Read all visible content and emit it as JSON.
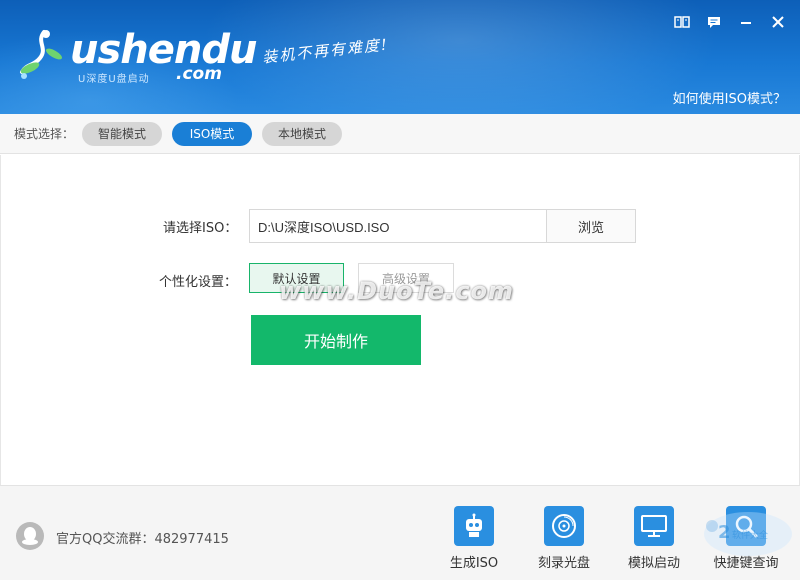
{
  "header": {
    "logo_text": "ushendu",
    "logo_sub": "U深度U盘启动",
    "logo_com": ".com",
    "slogan": "装机不再有难度!",
    "help_link": "如何使用ISO模式？",
    "icons": [
      "book-icon",
      "chat-icon",
      "minimize-icon",
      "close-icon"
    ]
  },
  "mode_bar": {
    "label": "模式选择：",
    "modes": [
      {
        "label": "智能模式",
        "active": false
      },
      {
        "label": "ISO模式",
        "active": true
      },
      {
        "label": "本地模式",
        "active": false
      }
    ]
  },
  "iso_section": {
    "label": "请选择ISO：",
    "value": "D:\\U深度ISO\\USD.ISO",
    "browse_label": "浏览"
  },
  "custom_section": {
    "label": "个性化设置：",
    "default_label": "默认设置",
    "advanced_label": "高级设置"
  },
  "start_button": "开始制作",
  "watermark": "www.DuoTe.com",
  "footer": {
    "qq_text": "官方QQ交流群：482977415",
    "tools": [
      {
        "label": "生成ISO",
        "icon": "robot-icon"
      },
      {
        "label": "刻录光盘",
        "icon": "disc-icon"
      },
      {
        "label": "模拟启动",
        "icon": "monitor-icon"
      },
      {
        "label": "快捷键查询",
        "icon": "magnifier-icon"
      }
    ]
  },
  "colors": {
    "header_blue": "#1878d4",
    "active_pill": "#1a7fd6",
    "start_green": "#13b86b",
    "tool_blue": "#2a8fe0"
  }
}
